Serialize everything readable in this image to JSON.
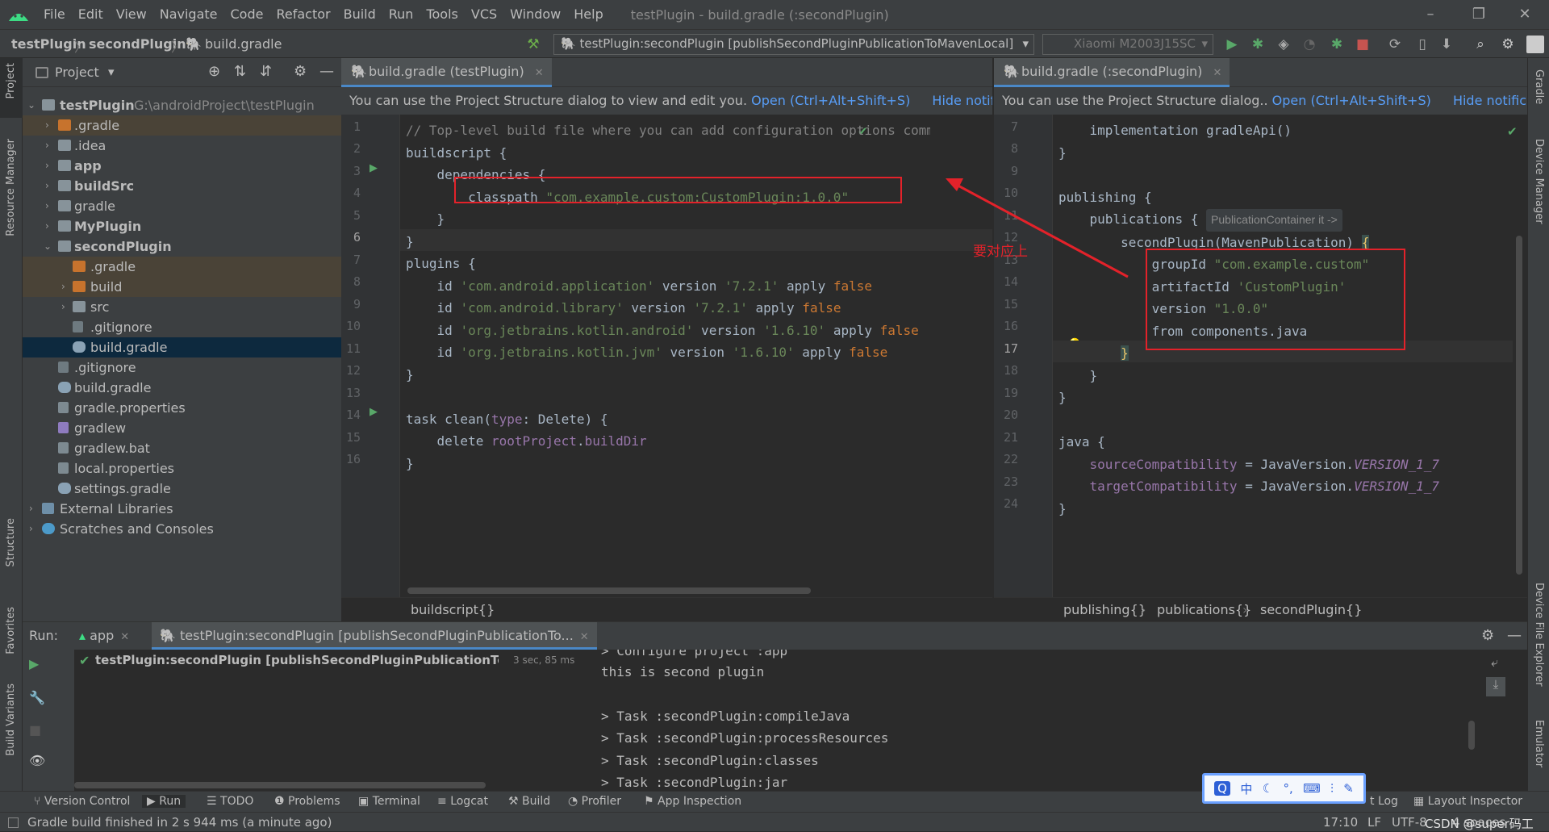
{
  "menu": {
    "items": [
      "File",
      "Edit",
      "View",
      "Navigate",
      "Code",
      "Refactor",
      "Build",
      "Run",
      "Tools",
      "VCS",
      "Window",
      "Help"
    ],
    "window_title": "testPlugin - build.gradle (:secondPlugin)"
  },
  "navbar": {
    "crumbs": [
      "testPlugin",
      "secondPlugin",
      "build.gradle"
    ],
    "run_config": "testPlugin:secondPlugin [publishSecondPluginPublicationToMavenLocal]",
    "device": "Xiaomi M2003J15SC"
  },
  "project": {
    "header": "Project",
    "root_name": "testPlugin",
    "root_path": "G:\\androidProject\\testPlugin",
    "items": [
      ".gradle",
      ".idea",
      "app",
      "buildSrc",
      "gradle",
      "MyPlugin",
      "secondPlugin",
      ".gradle",
      "build",
      "src",
      ".gitignore",
      "build.gradle",
      ".gitignore",
      "build.gradle",
      "gradle.properties",
      "gradlew",
      "gradlew.bat",
      "local.properties",
      "settings.gradle",
      "External Libraries",
      "Scratches and Consoles"
    ]
  },
  "editor_left": {
    "tab": "build.gradle (testPlugin)",
    "notif_text": "You can use the Project Structure dialog to view and edit you.",
    "notif_link": "Open (Ctrl+Alt+Shift+S)",
    "notif_hide": "Hide notification",
    "line_numbers": [
      "1",
      "2",
      "3",
      "4",
      "5",
      "6",
      "7",
      "8",
      "9",
      "10",
      "11",
      "12",
      "13",
      "14",
      "15",
      "16"
    ],
    "breadcrumb": "buildscript{}"
  },
  "editor_right": {
    "tab": "build.gradle (:secondPlugin)",
    "notif_text": "You can use the Project Structure dialog..",
    "notif_link": "Open (Ctrl+Alt+Shift+S)",
    "notif_hide": "Hide notification",
    "line_numbers": [
      "7",
      "8",
      "9",
      "10",
      "11",
      "12",
      "13",
      "14",
      "15",
      "16",
      "17",
      "18",
      "19",
      "20",
      "21",
      "22",
      "23",
      "24"
    ],
    "hint": "PublicationContainer it ->",
    "breadcrumbs": [
      "publishing{}",
      "publications{}",
      "secondPlugin{}"
    ]
  },
  "annotation": "要对应上",
  "run": {
    "label": "Run:",
    "tab_app": "app",
    "tab_task": "testPlugin:secondPlugin [publishSecondPluginPublicationTo...",
    "tree_item": "testPlugin:secondPlugin [publishSecondPluginPublicationToMavenL",
    "tree_time": "3 sec, 85 ms",
    "console": [
      "> Configure project :app",
      "this is second plugin",
      "",
      "> Task :secondPlugin:compileJava",
      "> Task :secondPlugin:processResources",
      "> Task :secondPlugin:classes",
      "> Task :secondPlugin:jar"
    ]
  },
  "bottom_tools": [
    "Version Control",
    "Run",
    "TODO",
    "Problems",
    "Terminal",
    "Logcat",
    "Build",
    "Profiler",
    "App Inspection",
    "t Log",
    "Layout Inspector"
  ],
  "left_stripe": [
    "Project",
    "Resource Manager",
    "Structure",
    "Favorites",
    "Build Variants"
  ],
  "right_stripe": [
    "Gradle",
    "Device Manager",
    "Device File Explorer",
    "Emulator"
  ],
  "status": {
    "message": "Gradle build finished in 2 s 944 ms (a minute ago)",
    "position": "17:10",
    "line_sep": "LF",
    "encoding": "UTF-8",
    "indent": "4 spaces",
    "watermark": "CSDN @super码工"
  },
  "ime": [
    "中"
  ]
}
